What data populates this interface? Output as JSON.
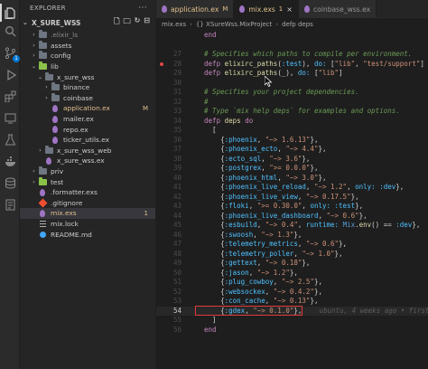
{
  "colors": {
    "accent": "#0078d4",
    "highlight": "#e23a3a"
  },
  "activity": {
    "icons": [
      "files-icon",
      "search-icon",
      "source-control-icon",
      "run-debug-icon",
      "extensions-icon",
      "remote-icon",
      "testing-icon",
      "docker-icon",
      "database-icon",
      "pages-icon"
    ],
    "badge": "1"
  },
  "explorer": {
    "title": "EXPLORER",
    "section": "X_SURE_WSS",
    "items": [
      {
        "label": ".elixir_ls",
        "indent": 1,
        "type": "folder",
        "twisty": "›",
        "sel": false
      },
      {
        "label": "assets",
        "indent": 1,
        "type": "folder",
        "twisty": "›",
        "sel": false
      },
      {
        "label": "config",
        "indent": 1,
        "type": "folder",
        "twisty": "›",
        "sel": false
      },
      {
        "label": "lib",
        "indent": 1,
        "type": "folder-green",
        "twisty": "⌄",
        "sel": false
      },
      {
        "label": "x_sure_wss",
        "indent": 2,
        "type": "folder",
        "twisty": "⌄",
        "sel": false
      },
      {
        "label": "binance",
        "indent": 3,
        "type": "folder",
        "twisty": "›",
        "sel": false
      },
      {
        "label": "coinbase",
        "indent": 3,
        "type": "folder",
        "twisty": "›",
        "sel": false
      },
      {
        "label": "application.ex",
        "indent": 3,
        "type": "elixir",
        "twisty": "",
        "sel": false,
        "mod": true,
        "mark": "M"
      },
      {
        "label": "mailer.ex",
        "indent": 3,
        "type": "elixir",
        "twisty": "",
        "sel": false
      },
      {
        "label": "repo.ex",
        "indent": 3,
        "type": "elixir",
        "twisty": "",
        "sel": false
      },
      {
        "label": "ticker_utils.ex",
        "indent": 3,
        "type": "elixir",
        "twisty": "",
        "sel": false
      },
      {
        "label": "x_sure_wss_web",
        "indent": 2,
        "type": "folder",
        "twisty": "›",
        "sel": false
      },
      {
        "label": "x_sure_wss.ex",
        "indent": 2,
        "type": "elixir",
        "twisty": "",
        "sel": false
      },
      {
        "label": "priv",
        "indent": 1,
        "type": "folder",
        "twisty": "›",
        "sel": false
      },
      {
        "label": "test",
        "indent": 1,
        "type": "folder-green",
        "twisty": "›",
        "sel": false
      },
      {
        "label": ".formatter.exs",
        "indent": 1,
        "type": "elixir",
        "twisty": "",
        "sel": false
      },
      {
        "label": ".gitignore",
        "indent": 1,
        "type": "git",
        "twisty": "",
        "sel": false
      },
      {
        "label": "mix.exs",
        "indent": 1,
        "type": "elixir",
        "twisty": "",
        "sel": true,
        "mod": true,
        "mark": "1"
      },
      {
        "label": "mix.lock",
        "indent": 1,
        "type": "lines",
        "twisty": "",
        "sel": false
      },
      {
        "label": "README.md",
        "indent": 1,
        "type": "info",
        "twisty": "",
        "sel": false
      }
    ]
  },
  "tabs": [
    {
      "label": "application.ex",
      "mark": "M",
      "active": false
    },
    {
      "label": "mix.exs",
      "mark": "1",
      "active": true
    },
    {
      "label": "coinbase_wss.ex",
      "mark": "",
      "active": false
    }
  ],
  "breadcrumb": [
    "mix.exs",
    "{} XSureWss.MixProject",
    "defp deps"
  ],
  "editor": {
    "blame": "ubuntu, 4 weeks ago • first",
    "lines": [
      {
        "n": "",
        "t": [
          {
            "c": "kw",
            "v": "  end"
          }
        ]
      },
      {
        "n": "",
        "t": []
      },
      {
        "n": "27",
        "t": [
          {
            "c": "cm",
            "v": "  # Specifies which paths to compile per environment."
          }
        ]
      },
      {
        "n": "28",
        "t": [
          {
            "c": "kw",
            "v": "  defp "
          },
          {
            "c": "fn",
            "v": "elixirc_paths"
          },
          {
            "c": "pl",
            "v": "("
          },
          {
            "c": "sym",
            "v": ":test"
          },
          {
            "c": "pl",
            "v": "), "
          },
          {
            "c": "sym",
            "v": "do: "
          },
          {
            "c": "pl",
            "v": "["
          },
          {
            "c": "str",
            "v": "\"lib\""
          },
          {
            "c": "pl",
            "v": ", "
          },
          {
            "c": "str",
            "v": "\"test/support\""
          },
          {
            "c": "pl",
            "v": "]"
          }
        ],
        "dot": true
      },
      {
        "n": "29",
        "t": [
          {
            "c": "kw",
            "v": "  defp "
          },
          {
            "c": "fn",
            "v": "elixirc_paths"
          },
          {
            "c": "pl",
            "v": "(_), "
          },
          {
            "c": "sym",
            "v": "do: "
          },
          {
            "c": "pl",
            "v": "["
          },
          {
            "c": "str",
            "v": "\"lib\""
          },
          {
            "c": "pl",
            "v": "]"
          }
        ]
      },
      {
        "n": "30",
        "t": []
      },
      {
        "n": "31",
        "t": [
          {
            "c": "cm",
            "v": "  # Specifies your project dependencies."
          }
        ]
      },
      {
        "n": "32",
        "t": [
          {
            "c": "cm",
            "v": "  #"
          }
        ]
      },
      {
        "n": "33",
        "t": [
          {
            "c": "cm",
            "v": "  # Type `mix help deps` for examples and options."
          }
        ]
      },
      {
        "n": "34",
        "t": [
          {
            "c": "kw",
            "v": "  defp "
          },
          {
            "c": "fn",
            "v": "deps "
          },
          {
            "c": "kw",
            "v": "do"
          }
        ]
      },
      {
        "n": "35",
        "t": [
          {
            "c": "pl",
            "v": "    ["
          }
        ]
      },
      {
        "n": "36",
        "t": [
          {
            "c": "pl",
            "v": "      {"
          },
          {
            "c": "sym",
            "v": ":phoenix"
          },
          {
            "c": "pl",
            "v": ", "
          },
          {
            "c": "str",
            "v": "\"~> 1.6.13\""
          },
          {
            "c": "pl",
            "v": "},"
          }
        ]
      },
      {
        "n": "37",
        "t": [
          {
            "c": "pl",
            "v": "      {"
          },
          {
            "c": "sym",
            "v": ":phoenix_ecto"
          },
          {
            "c": "pl",
            "v": ", "
          },
          {
            "c": "str",
            "v": "\"~> 4.4\""
          },
          {
            "c": "pl",
            "v": "},"
          }
        ]
      },
      {
        "n": "38",
        "t": [
          {
            "c": "pl",
            "v": "      {"
          },
          {
            "c": "sym",
            "v": ":ecto_sql"
          },
          {
            "c": "pl",
            "v": ", "
          },
          {
            "c": "str",
            "v": "\"~> 3.6\""
          },
          {
            "c": "pl",
            "v": "},"
          }
        ]
      },
      {
        "n": "39",
        "t": [
          {
            "c": "pl",
            "v": "      {"
          },
          {
            "c": "sym",
            "v": ":postgrex"
          },
          {
            "c": "pl",
            "v": ", "
          },
          {
            "c": "str",
            "v": "\">= 0.0.0\""
          },
          {
            "c": "pl",
            "v": "},"
          }
        ]
      },
      {
        "n": "40",
        "t": [
          {
            "c": "pl",
            "v": "      {"
          },
          {
            "c": "sym",
            "v": ":phoenix_html"
          },
          {
            "c": "pl",
            "v": ", "
          },
          {
            "c": "str",
            "v": "\"~> 3.0\""
          },
          {
            "c": "pl",
            "v": "},"
          }
        ]
      },
      {
        "n": "41",
        "t": [
          {
            "c": "pl",
            "v": "      {"
          },
          {
            "c": "sym",
            "v": ":phoenix_live_reload"
          },
          {
            "c": "pl",
            "v": ", "
          },
          {
            "c": "str",
            "v": "\"~> 1.2\""
          },
          {
            "c": "pl",
            "v": ", "
          },
          {
            "c": "sym",
            "v": "only: :dev"
          },
          {
            "c": "pl",
            "v": "},"
          }
        ]
      },
      {
        "n": "42",
        "t": [
          {
            "c": "pl",
            "v": "      {"
          },
          {
            "c": "sym",
            "v": ":phoenix_live_view"
          },
          {
            "c": "pl",
            "v": ", "
          },
          {
            "c": "str",
            "v": "\"~> 0.17.5\""
          },
          {
            "c": "pl",
            "v": "},"
          }
        ]
      },
      {
        "n": "43",
        "t": [
          {
            "c": "pl",
            "v": "      {"
          },
          {
            "c": "sym",
            "v": ":floki"
          },
          {
            "c": "pl",
            "v": ", "
          },
          {
            "c": "str",
            "v": "\">= 0.30.0\""
          },
          {
            "c": "pl",
            "v": ", "
          },
          {
            "c": "sym",
            "v": "only: :test"
          },
          {
            "c": "pl",
            "v": "},"
          }
        ]
      },
      {
        "n": "44",
        "t": [
          {
            "c": "pl",
            "v": "      {"
          },
          {
            "c": "sym",
            "v": ":phoenix_live_dashboard"
          },
          {
            "c": "pl",
            "v": ", "
          },
          {
            "c": "str",
            "v": "\"~> 0.6\""
          },
          {
            "c": "pl",
            "v": "},"
          }
        ]
      },
      {
        "n": "45",
        "t": [
          {
            "c": "pl",
            "v": "      {"
          },
          {
            "c": "sym",
            "v": ":esbuild"
          },
          {
            "c": "pl",
            "v": ", "
          },
          {
            "c": "str",
            "v": "\"~> 0.4\""
          },
          {
            "c": "pl",
            "v": ", "
          },
          {
            "c": "sym",
            "v": "runtime: "
          },
          {
            "c": "hdr",
            "v": "Mix"
          },
          {
            "c": "pl",
            "v": "."
          },
          {
            "c": "fn",
            "v": "env"
          },
          {
            "c": "pl",
            "v": "() == "
          },
          {
            "c": "sym",
            "v": ":dev"
          },
          {
            "c": "pl",
            "v": "},"
          }
        ]
      },
      {
        "n": "46",
        "t": [
          {
            "c": "pl",
            "v": "      {"
          },
          {
            "c": "sym",
            "v": ":swoosh"
          },
          {
            "c": "pl",
            "v": ", "
          },
          {
            "c": "str",
            "v": "\"~> 1.3\""
          },
          {
            "c": "pl",
            "v": "},"
          }
        ]
      },
      {
        "n": "47",
        "t": [
          {
            "c": "pl",
            "v": "      {"
          },
          {
            "c": "sym",
            "v": ":telemetry_metrics"
          },
          {
            "c": "pl",
            "v": ", "
          },
          {
            "c": "str",
            "v": "\"~> 0.6\""
          },
          {
            "c": "pl",
            "v": "},"
          }
        ]
      },
      {
        "n": "48",
        "t": [
          {
            "c": "pl",
            "v": "      {"
          },
          {
            "c": "sym",
            "v": ":telemetry_poller"
          },
          {
            "c": "pl",
            "v": ", "
          },
          {
            "c": "str",
            "v": "\"~> 1.0\""
          },
          {
            "c": "pl",
            "v": "},"
          }
        ]
      },
      {
        "n": "49",
        "t": [
          {
            "c": "pl",
            "v": "      {"
          },
          {
            "c": "sym",
            "v": ":gettext"
          },
          {
            "c": "pl",
            "v": ", "
          },
          {
            "c": "str",
            "v": "\"~> 0.18\""
          },
          {
            "c": "pl",
            "v": "},"
          }
        ]
      },
      {
        "n": "50",
        "t": [
          {
            "c": "pl",
            "v": "      {"
          },
          {
            "c": "sym",
            "v": ":jason"
          },
          {
            "c": "pl",
            "v": ", "
          },
          {
            "c": "str",
            "v": "\"~> 1.2\""
          },
          {
            "c": "pl",
            "v": "},"
          }
        ]
      },
      {
        "n": "51",
        "t": [
          {
            "c": "pl",
            "v": "      {"
          },
          {
            "c": "sym",
            "v": ":plug_cowboy"
          },
          {
            "c": "pl",
            "v": ", "
          },
          {
            "c": "str",
            "v": "\"~> 2.5\""
          },
          {
            "c": "pl",
            "v": "},"
          }
        ]
      },
      {
        "n": "52",
        "t": [
          {
            "c": "pl",
            "v": "      {"
          },
          {
            "c": "sym",
            "v": ":websockex"
          },
          {
            "c": "pl",
            "v": ", "
          },
          {
            "c": "str",
            "v": "\"~> 0.4.2\""
          },
          {
            "c": "pl",
            "v": "},"
          }
        ]
      },
      {
        "n": "53",
        "t": [
          {
            "c": "pl",
            "v": "      {"
          },
          {
            "c": "sym",
            "v": ":con_cache"
          },
          {
            "c": "pl",
            "v": ", "
          },
          {
            "c": "str",
            "v": "\"~> 0.13\""
          },
          {
            "c": "pl",
            "v": "},"
          }
        ]
      },
      {
        "n": "54",
        "t": [
          {
            "c": "pl",
            "v": "      {"
          },
          {
            "c": "sym",
            "v": ":gdex"
          },
          {
            "c": "pl",
            "v": ", "
          },
          {
            "c": "str",
            "v": "\"~> 0.1.0\""
          },
          {
            "c": "pl",
            "v": "},"
          }
        ],
        "cur": true
      },
      {
        "n": "55",
        "t": [
          {
            "c": "pl",
            "v": "    ]"
          }
        ]
      },
      {
        "n": "56",
        "t": [
          {
            "c": "kw",
            "v": "  end"
          }
        ]
      }
    ]
  }
}
